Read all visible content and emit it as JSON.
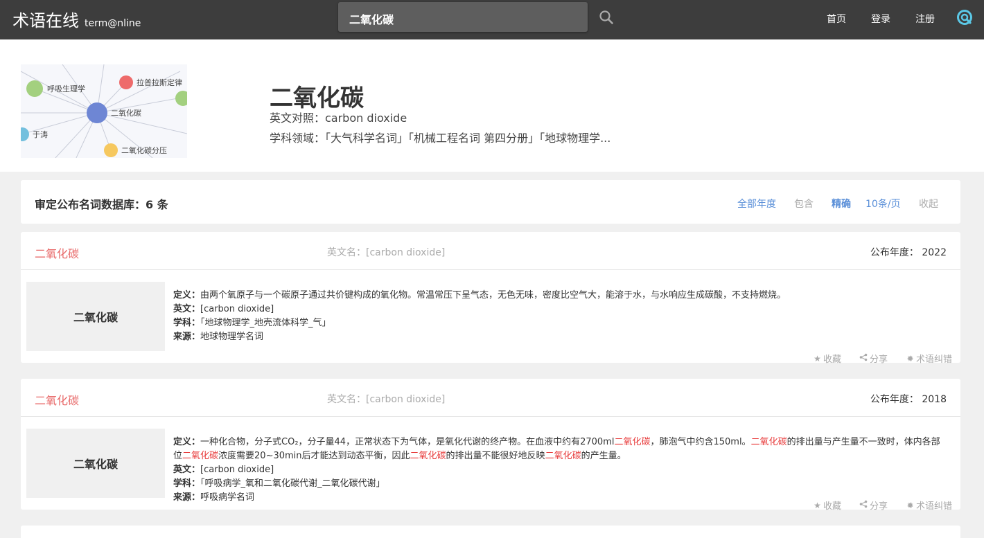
{
  "header": {
    "logo_cn": "术语在线",
    "logo_en": "term@nline",
    "search_value": "二氧化碳",
    "nav": {
      "home": "首页",
      "login": "登录",
      "register": "注册"
    }
  },
  "hero": {
    "title": "二氧化碳",
    "english": "英文对照：carbon dioxide",
    "fields": "学科领域：「大气科学名词」「机械工程名词 第四分册」「地球物理学...",
    "graph_nodes": {
      "center": "二氧化碳",
      "n1": "呼吸生理学",
      "n2": "拉普拉斯定律",
      "n3": "于涛",
      "n4": "二氧化碳分压"
    }
  },
  "summary": {
    "title": "审定公布名词数据库：6 条",
    "filters": {
      "year": "全部年度",
      "contain": "包含",
      "exact": "精确",
      "per_page": "10条/页",
      "fold": "收起"
    }
  },
  "labels": {
    "definition": "定义：",
    "english": "英文：",
    "subject": "学科：",
    "source": "来源：",
    "year": "公布年度：",
    "favorite": "收藏",
    "share": "分享",
    "report": "术语纠错"
  },
  "results": [
    {
      "term": "二氧化碳",
      "english_name": "英文名：[carbon dioxide]",
      "year": "2022",
      "thumb": "二氧化碳",
      "definition": "由两个氧原子与一个碳原子通过共价键构成的氧化物。常温常压下呈气态，无色无味，密度比空气大，能溶于水，与水响应生成碳酸，不支持燃烧。",
      "english": "[carbon dioxide]",
      "subject": "「地球物理学_地壳流体科学_气」",
      "source": "地球物理学名词"
    },
    {
      "term": "二氧化碳",
      "english_name": "英文名：[carbon dioxide]",
      "year": "2018",
      "thumb": "二氧化碳",
      "def_parts": [
        "一种化合物，分子式CO₂，分子量44，正常状态下为气体，是氧化代谢的终产物。在血液中约有2700ml",
        "二氧化碳",
        "，肺泡气中约含150ml。",
        "二氧化碳",
        "的排出量与产生量不一致时，体内各部位",
        "二氧化碳",
        "浓度需要20~30min后才能达到动态平衡，因此",
        "二氧化碳",
        "的排出量不能很好地反映",
        "二氧化碳",
        "的产生量。"
      ],
      "english": "[carbon dioxide]",
      "subject": "「呼吸病学_氧和二氧化碳代谢_二氧化碳代谢」",
      "source": "呼吸病学名词"
    }
  ]
}
